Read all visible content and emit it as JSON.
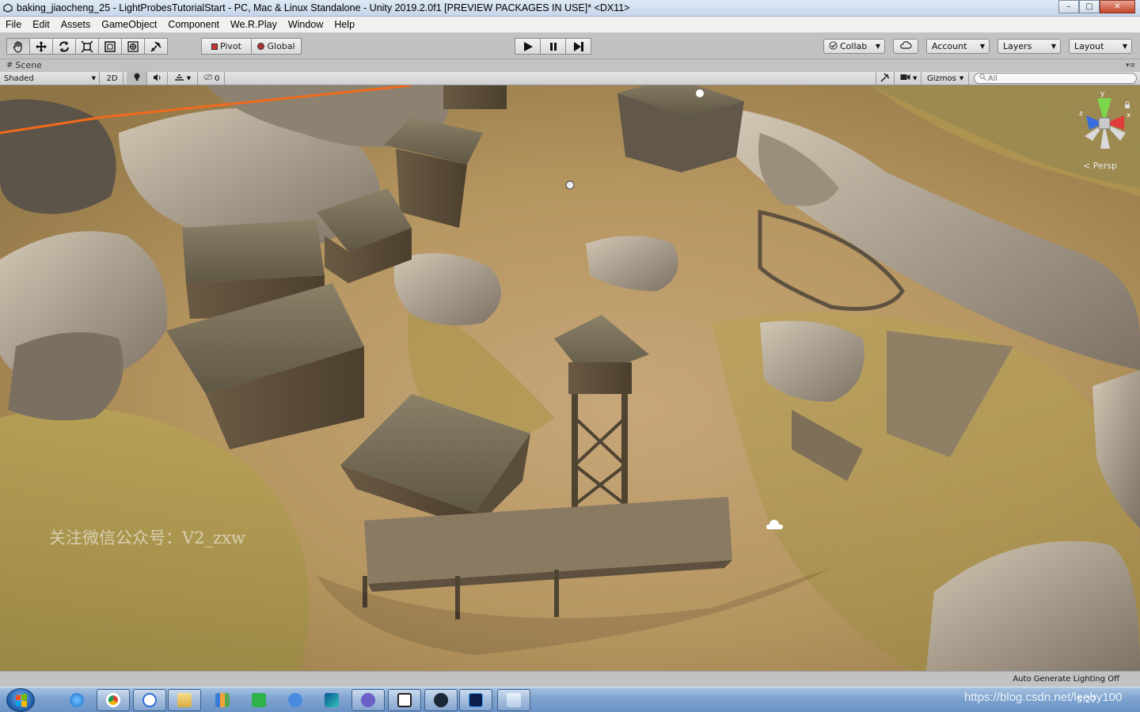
{
  "window": {
    "title": "baking_jiaocheng_25 - LightProbesTutorialStart - PC, Mac & Linux Standalone - Unity 2019.2.0f1 [PREVIEW PACKAGES IN USE]* <DX11>",
    "controls": {
      "minimize": "–",
      "maximize": "□",
      "close": "✕"
    }
  },
  "menu": [
    "File",
    "Edit",
    "Assets",
    "GameObject",
    "Component",
    "We.R.Play",
    "Window",
    "Help"
  ],
  "toolbar": {
    "transform_tools": [
      "hand-icon",
      "move-icon",
      "rotate-icon",
      "scale-icon",
      "rect-icon",
      "transform-icon",
      "custom-tool-icon"
    ],
    "pivot_label": "Pivot",
    "global_label": "Global",
    "play_controls": [
      "play-icon",
      "pause-icon",
      "step-icon"
    ],
    "collab_label": "Collab",
    "account_label": "Account",
    "layers_label": "Layers",
    "layout_label": "Layout"
  },
  "scene": {
    "tab_label": "Scene",
    "shading_mode": "Shaded",
    "mode_2d": "2D",
    "hidden_count": "0",
    "gizmos_label": "Gizmos",
    "search_placeholder": "All",
    "projection_label": "Persp",
    "axis_labels": {
      "x": "x",
      "y": "y",
      "z": "z"
    },
    "watermark": "关注微信公众号：V2_zxw"
  },
  "status": {
    "lighting": "Auto Generate Lighting Off"
  },
  "taskbar": {
    "apps": [
      "ie-icon",
      "chrome-icon",
      "baidu-icon",
      "explorer-icon",
      "chart-app-icon",
      "wps-icon",
      "qq-icon",
      "rider-icon",
      "vs-icon",
      "unity-icon",
      "steam-icon",
      "photoshop-icon",
      "notepad-icon"
    ],
    "tray_url": "https://blog.csdn.net/leeby100",
    "clock": "5:27"
  },
  "colors": {
    "accent_orange": "#f26a1b",
    "unity_gray": "#c2c2c2",
    "taskbar_blue": "#7fa3cf"
  }
}
